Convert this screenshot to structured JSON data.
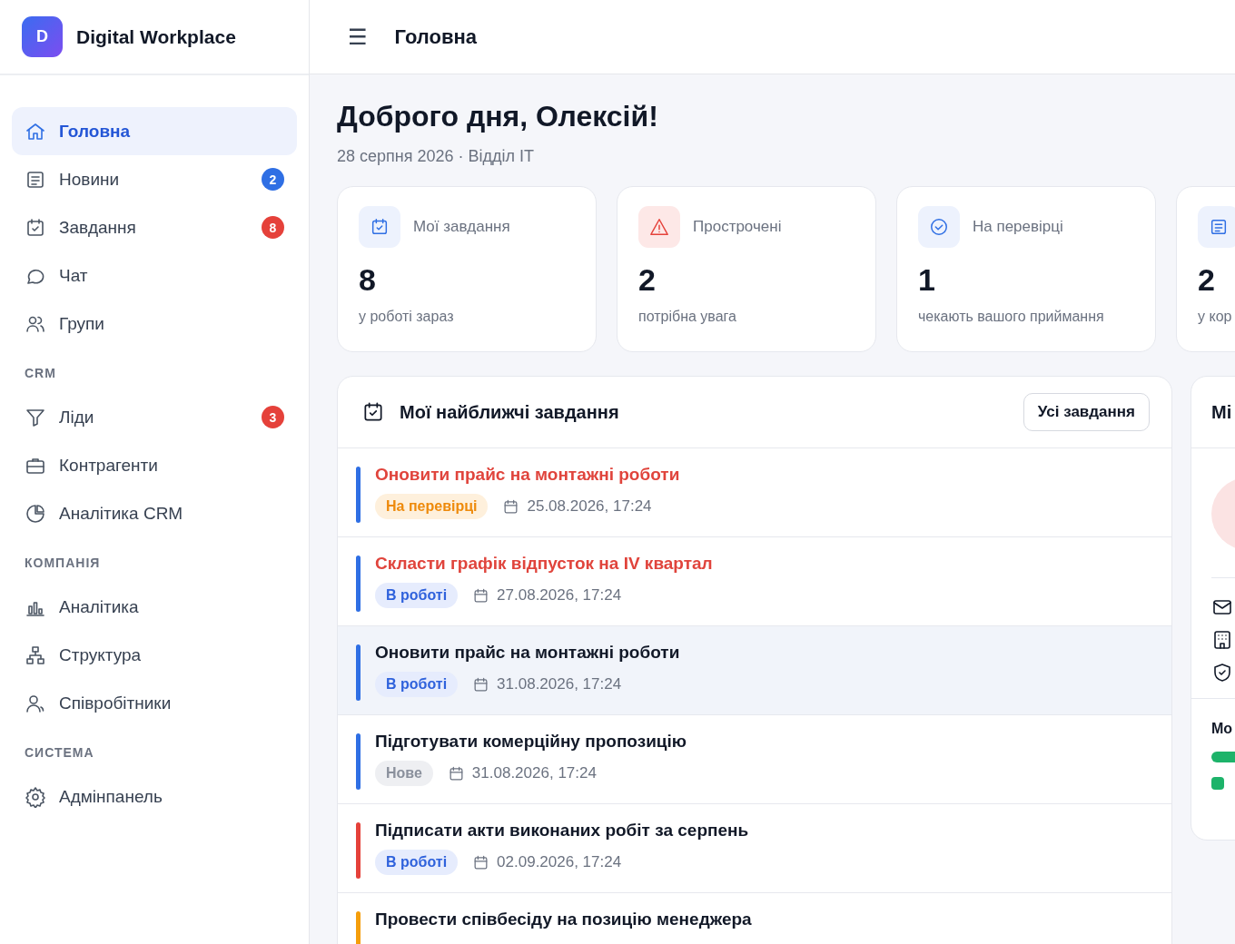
{
  "brand": {
    "logo_letter": "D",
    "name": "Digital Workplace"
  },
  "header": {
    "menu_icon": "☰",
    "title": "Головна"
  },
  "sidebar": {
    "groups": [
      {
        "items": [
          {
            "label": "Головна",
            "selected": true
          },
          {
            "label": "Новини",
            "selected": false,
            "badge": {
              "text": "2",
              "color": "#2f6fe4"
            }
          },
          {
            "label": "Завдання",
            "selected": false,
            "badge": {
              "text": "8",
              "color": "#e5413a"
            }
          },
          {
            "label": "Чат",
            "selected": false
          },
          {
            "label": "Групи",
            "selected": false
          }
        ]
      },
      {
        "title": "CRM",
        "items": [
          {
            "label": "Ліди",
            "selected": false,
            "badge": {
              "text": "3",
              "color": "#e5413a"
            }
          },
          {
            "label": "Контрагенти",
            "selected": false
          },
          {
            "label": "Аналітика CRM",
            "selected": false
          }
        ]
      },
      {
        "title": "КОМПАНІЯ",
        "items": [
          {
            "label": "Аналітика",
            "selected": false
          },
          {
            "label": "Структура",
            "selected": false
          },
          {
            "label": "Співробітники",
            "selected": false
          }
        ]
      },
      {
        "title": "СИСТЕМА",
        "items": [
          {
            "label": "Адмінпанель",
            "selected": false
          }
        ]
      }
    ]
  },
  "greeting": {
    "title": "Доброго дня, Олексій!",
    "subtitle": "28 серпня 2026 · Відділ IT"
  },
  "stats": [
    {
      "kind": "info",
      "label": "Мої завдання",
      "value": "8",
      "caption": "у роботі зараз"
    },
    {
      "kind": "danger",
      "label": "Прострочені",
      "value": "2",
      "caption": "потрібна увага"
    },
    {
      "kind": "info",
      "label": "На перевірці",
      "value": "1",
      "caption": "чекають вашого приймання"
    },
    {
      "kind": "info",
      "value": "2",
      "caption": "у кор"
    }
  ],
  "tasks": {
    "title": "Мої найближчі завдання",
    "all_button": "Усі завдання",
    "items": [
      {
        "title": "Оновити прайс на монтажні роботи",
        "overdue": true,
        "hovered": false,
        "color": "#2f6fe4",
        "status": {
          "label": "На перевірці",
          "kind": "review"
        },
        "due": "25.08.2026, 17:24"
      },
      {
        "title": "Скласти графік відпусток на IV квартал",
        "overdue": true,
        "hovered": false,
        "color": "#2f6fe4",
        "status": {
          "label": "В роботі",
          "kind": "in_progress"
        },
        "due": "27.08.2026, 17:24"
      },
      {
        "title": "Оновити прайс на монтажні роботи",
        "overdue": false,
        "hovered": true,
        "color": "#2f6fe4",
        "status": {
          "label": "В роботі",
          "kind": "in_progress"
        },
        "due": "31.08.2026, 17:24"
      },
      {
        "title": "Підготувати комерційну пропозицію",
        "overdue": false,
        "hovered": false,
        "color": "#2f6fe4",
        "status": {
          "label": "Нове",
          "kind": "new"
        },
        "due": "31.08.2026, 17:24"
      },
      {
        "title": "Підписати акти виконаних робіт за серпень",
        "overdue": false,
        "hovered": false,
        "color": "#e5413a",
        "status": {
          "label": "В роботі",
          "kind": "in_progress"
        },
        "due": "02.09.2026, 17:24"
      },
      {
        "title": "Провести співбесіду на позицію менеджера",
        "overdue": false,
        "hovered": false,
        "color": "#f59e0b"
      }
    ]
  },
  "profile_panel": {
    "title": "Mi",
    "section_title": "Mo"
  }
}
